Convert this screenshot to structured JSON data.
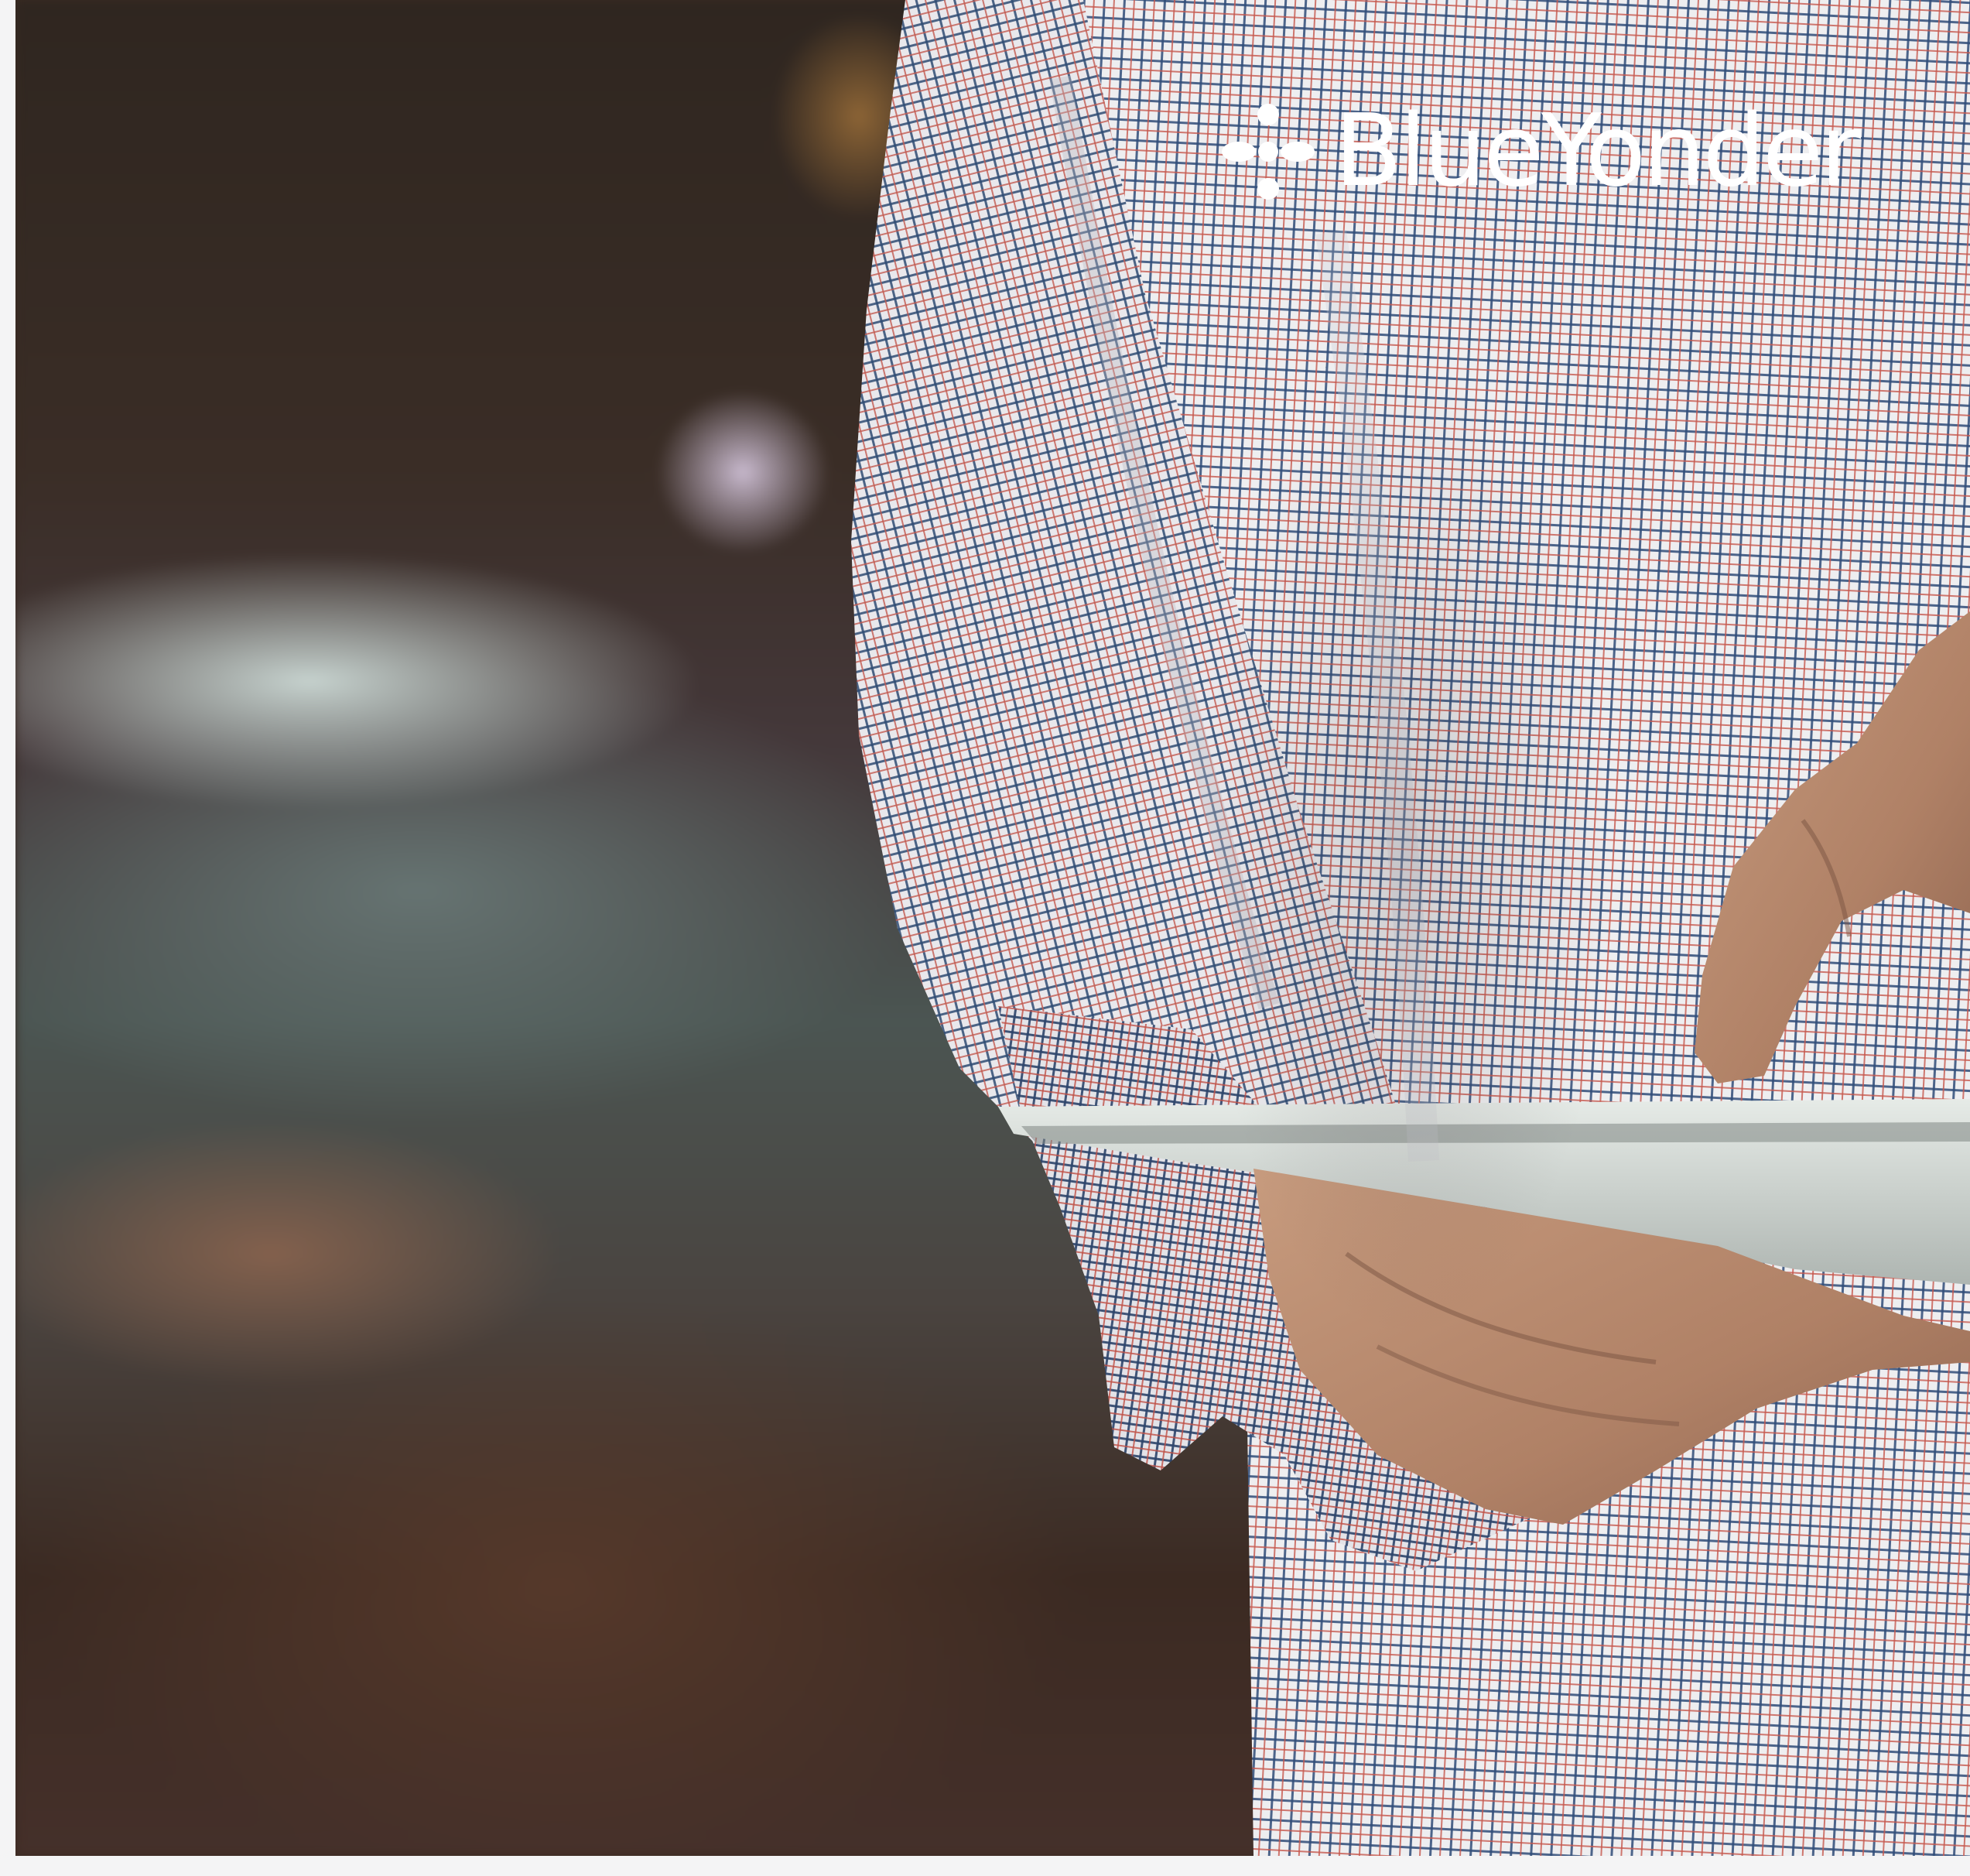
{
  "brand": {
    "name": "BlueYonder",
    "logo_icon": "blue-yonder-flower-mark",
    "logo_color": "#ffffff"
  },
  "photo": {
    "palette": {
      "background": "#3a2a22",
      "shirt_base": "#eeeef0",
      "check_blue": "#304d78",
      "check_red": "#c5574d",
      "skin": "#b98d70",
      "tablet": "#d7dcd8"
    }
  }
}
